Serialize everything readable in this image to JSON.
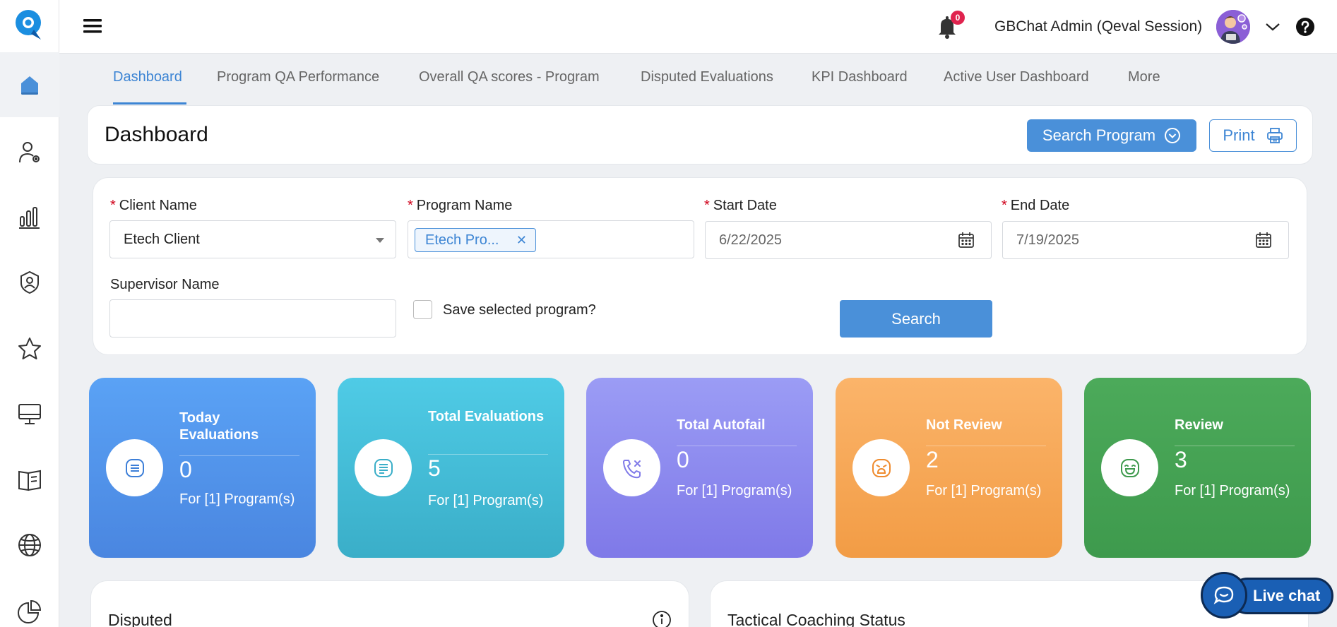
{
  "topbar": {
    "notification_count": "0",
    "user_name": "GBChat Admin (Qeval Session)"
  },
  "sidebar": {
    "items": [
      {
        "icon": "home-icon"
      },
      {
        "icon": "user-settings-icon"
      },
      {
        "icon": "bar-chart-icon"
      },
      {
        "icon": "shield-person-icon"
      },
      {
        "icon": "star-icon"
      },
      {
        "icon": "monitor-icon"
      },
      {
        "icon": "book-icon"
      },
      {
        "icon": "globe-icon"
      },
      {
        "icon": "pie-chart-icon"
      }
    ]
  },
  "tabs": [
    {
      "label": "Dashboard",
      "active": true
    },
    {
      "label": "Program QA Performance"
    },
    {
      "label": "Overall QA scores - Program"
    },
    {
      "label": "Disputed Evaluations"
    },
    {
      "label": "KPI Dashboard"
    },
    {
      "label": "Active User Dashboard"
    },
    {
      "label": "More"
    }
  ],
  "header": {
    "title": "Dashboard",
    "search_program_label": "Search Program",
    "print_label": "Print"
  },
  "filters": {
    "client_label": "Client Name",
    "client_value": "Etech Client",
    "program_label": "Program Name",
    "program_tag": "Etech Pro...",
    "start_label": "Start Date",
    "start_value": "6/22/2025",
    "end_label": "End Date",
    "end_value": "7/19/2025",
    "supervisor_label": "Supervisor Name",
    "supervisor_value": "",
    "save_label": "Save selected program?",
    "search_label": "Search"
  },
  "stats": [
    {
      "title": "Today Evaluations",
      "value": "0",
      "sub": "For [1] Program(s)",
      "color_from": "#5aa2f5",
      "color_to": "#4a86e0"
    },
    {
      "title": "Total Evaluations",
      "value": "5",
      "sub": "For [1] Program(s)",
      "color_from": "#4fcbe6",
      "color_to": "#3aaec8"
    },
    {
      "title": "Total Autofail",
      "value": "0",
      "sub": "For [1] Program(s)",
      "color_from": "#9b9cf5",
      "color_to": "#7f79e8"
    },
    {
      "title": "Not Review",
      "value": "2",
      "sub": "For [1] Program(s)",
      "color_from": "#fbb46a",
      "color_to": "#f29c45"
    },
    {
      "title": "Review",
      "value": "3",
      "sub": "For [1] Program(s)",
      "color_from": "#4caa5a",
      "color_to": "#3e9a4d"
    }
  ],
  "bottom": {
    "disputed_title": "Disputed",
    "coaching_title": "Tactical Coaching Status"
  },
  "livechat": {
    "label": "Live chat"
  }
}
